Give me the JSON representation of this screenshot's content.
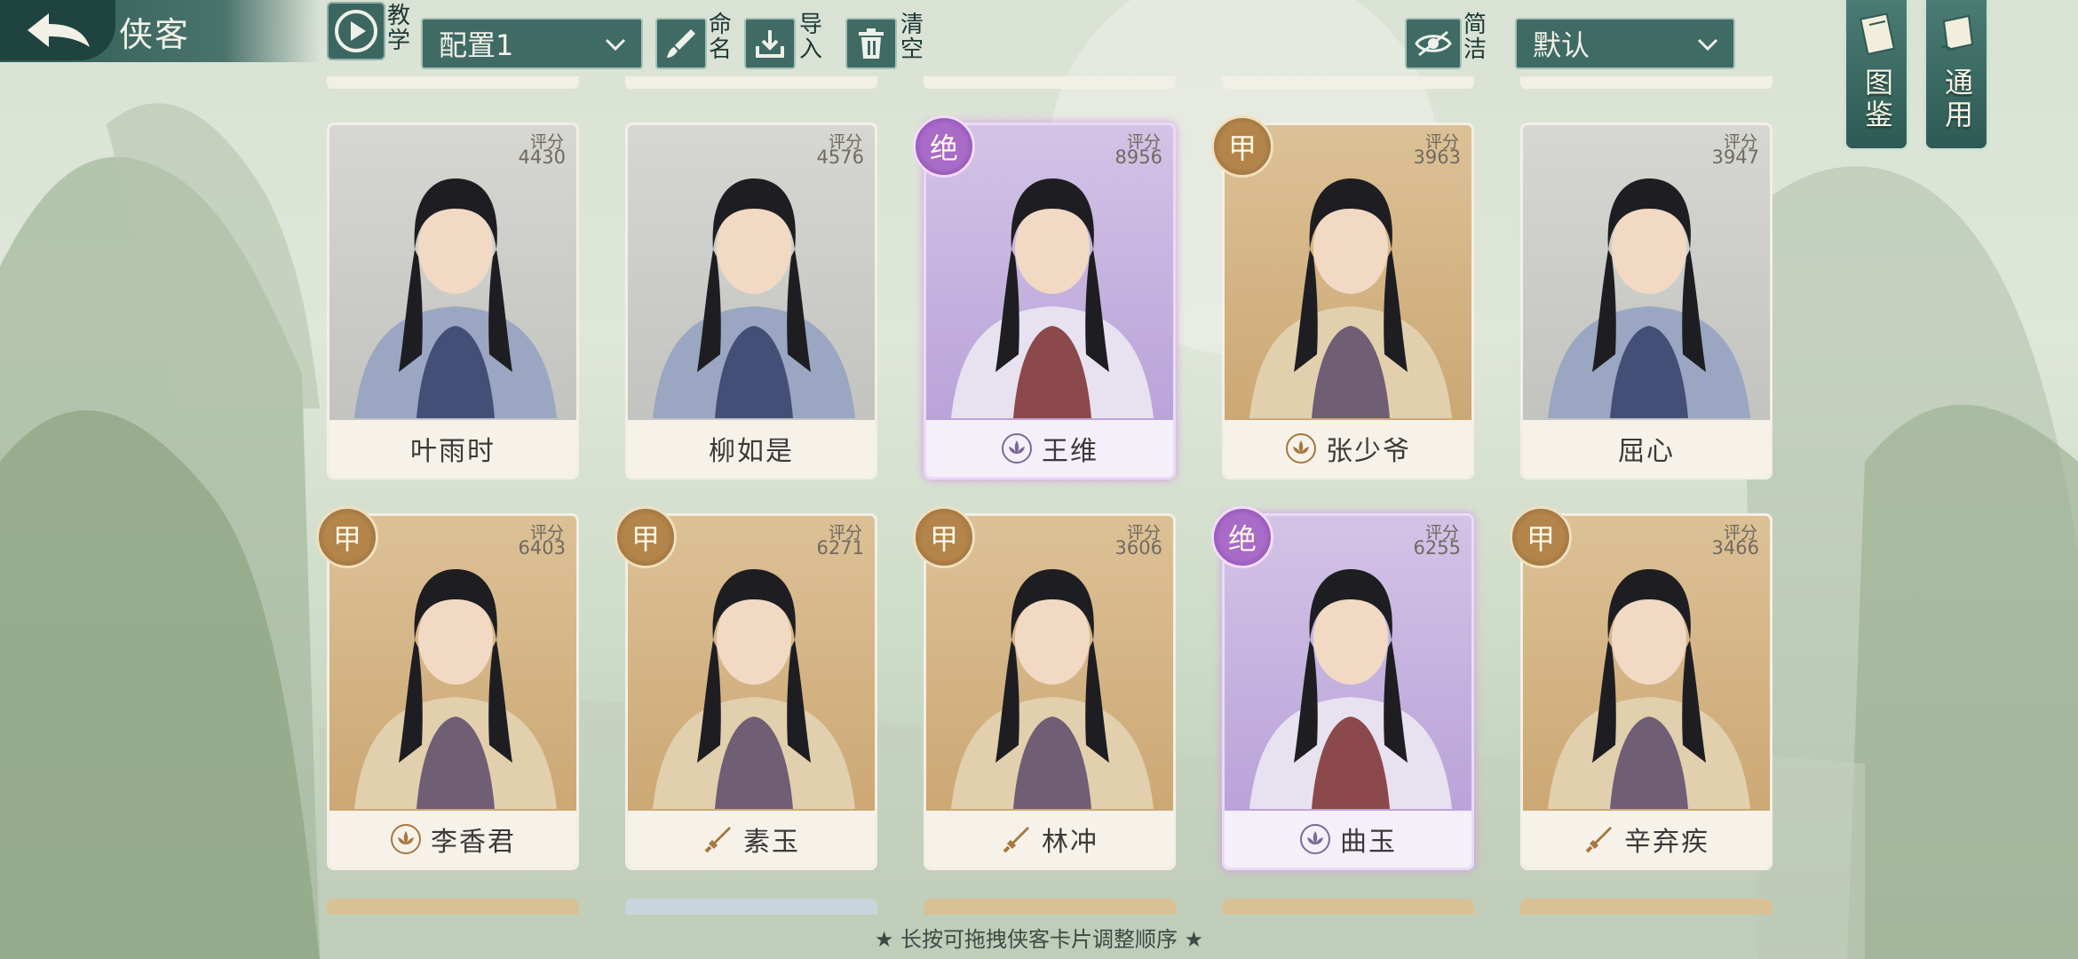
{
  "header": {
    "title": "侠客",
    "tutorial_label": "教学",
    "config_select": "配置1",
    "rename_label": "命名",
    "import_label": "导入",
    "clear_label": "清空",
    "simple_label": "简洁",
    "sort_select": "默认"
  },
  "side_buttons": {
    "codex_label": "图鉴",
    "general_label": "通用"
  },
  "cards": [
    {
      "name": "叶雨时",
      "score_label": "评分",
      "score": "4430",
      "rarity": "gray",
      "badge": "",
      "tag": ""
    },
    {
      "name": "柳如是",
      "score_label": "评分",
      "score": "4576",
      "rarity": "gray",
      "badge": "",
      "tag": ""
    },
    {
      "name": "王维",
      "score_label": "评分",
      "score": "8956",
      "rarity": "purple",
      "badge": "绝",
      "tag": "lotus"
    },
    {
      "name": "张少爷",
      "score_label": "评分",
      "score": "3963",
      "rarity": "gold",
      "badge": "甲",
      "tag": "lotus"
    },
    {
      "name": "屈心",
      "score_label": "评分",
      "score": "3947",
      "rarity": "gray",
      "badge": "",
      "tag": ""
    },
    {
      "name": "李香君",
      "score_label": "评分",
      "score": "6403",
      "rarity": "gold",
      "badge": "甲",
      "tag": "lotus"
    },
    {
      "name": "素玉",
      "score_label": "评分",
      "score": "6271",
      "rarity": "gold",
      "badge": "甲",
      "tag": "sword"
    },
    {
      "name": "林冲",
      "score_label": "评分",
      "score": "3606",
      "rarity": "gold",
      "badge": "甲",
      "tag": "sword"
    },
    {
      "name": "曲玉",
      "score_label": "评分",
      "score": "6255",
      "rarity": "purple",
      "badge": "绝",
      "tag": "lotus"
    },
    {
      "name": "辛弃疾",
      "score_label": "评分",
      "score": "3466",
      "rarity": "gold",
      "badge": "甲",
      "tag": "sword"
    }
  ],
  "footer": {
    "hint": "★ 长按可拖拽侠客卡片调整顺序 ★"
  },
  "colors": {
    "accent": "#3f6b64",
    "gold": "#c9a36e",
    "purple": "#b59dd6"
  }
}
